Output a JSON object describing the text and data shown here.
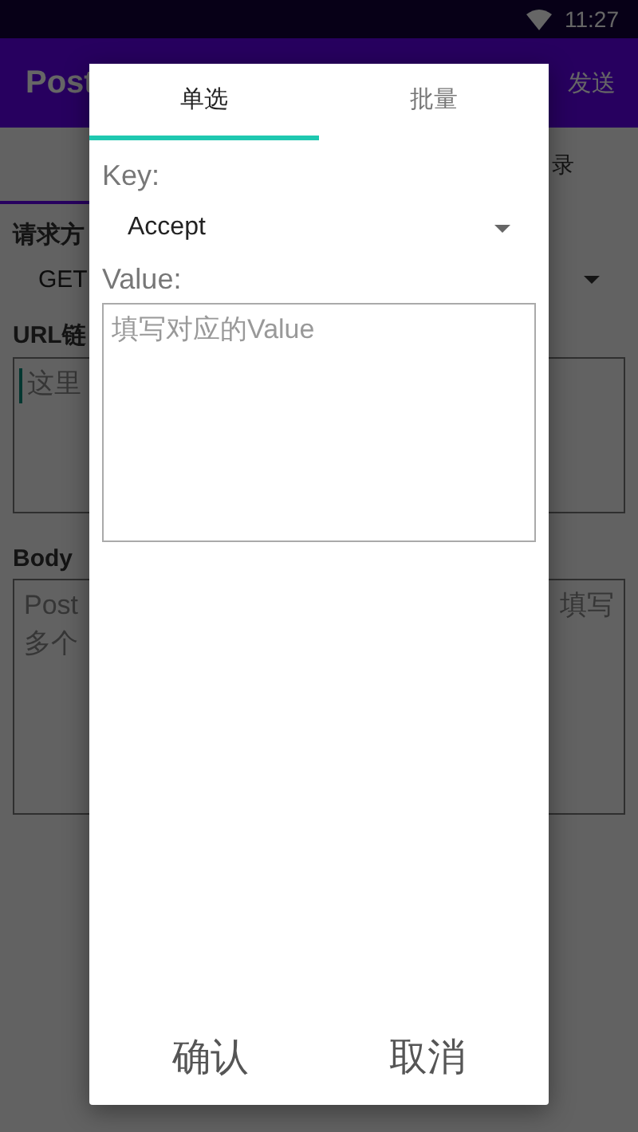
{
  "status_bar": {
    "time": "11:27"
  },
  "background": {
    "app_title": "Post",
    "send": "发送",
    "tab_right": "录",
    "method_label": "请求方",
    "method_value": "GET",
    "url_label": "URL链",
    "url_placeholder": "这里",
    "body_label": "Body",
    "body_placeholder_left": [
      "Post",
      "多个"
    ],
    "body_placeholder_right": "填写"
  },
  "dialog": {
    "tabs": [
      {
        "label": "单选",
        "selected": true
      },
      {
        "label": "批量",
        "selected": false
      }
    ],
    "key_label": "Key:",
    "key_value": "Accept",
    "value_label": "Value:",
    "value_placeholder": "填写对应的Value",
    "buttons": [
      "确认",
      "取消"
    ]
  }
}
